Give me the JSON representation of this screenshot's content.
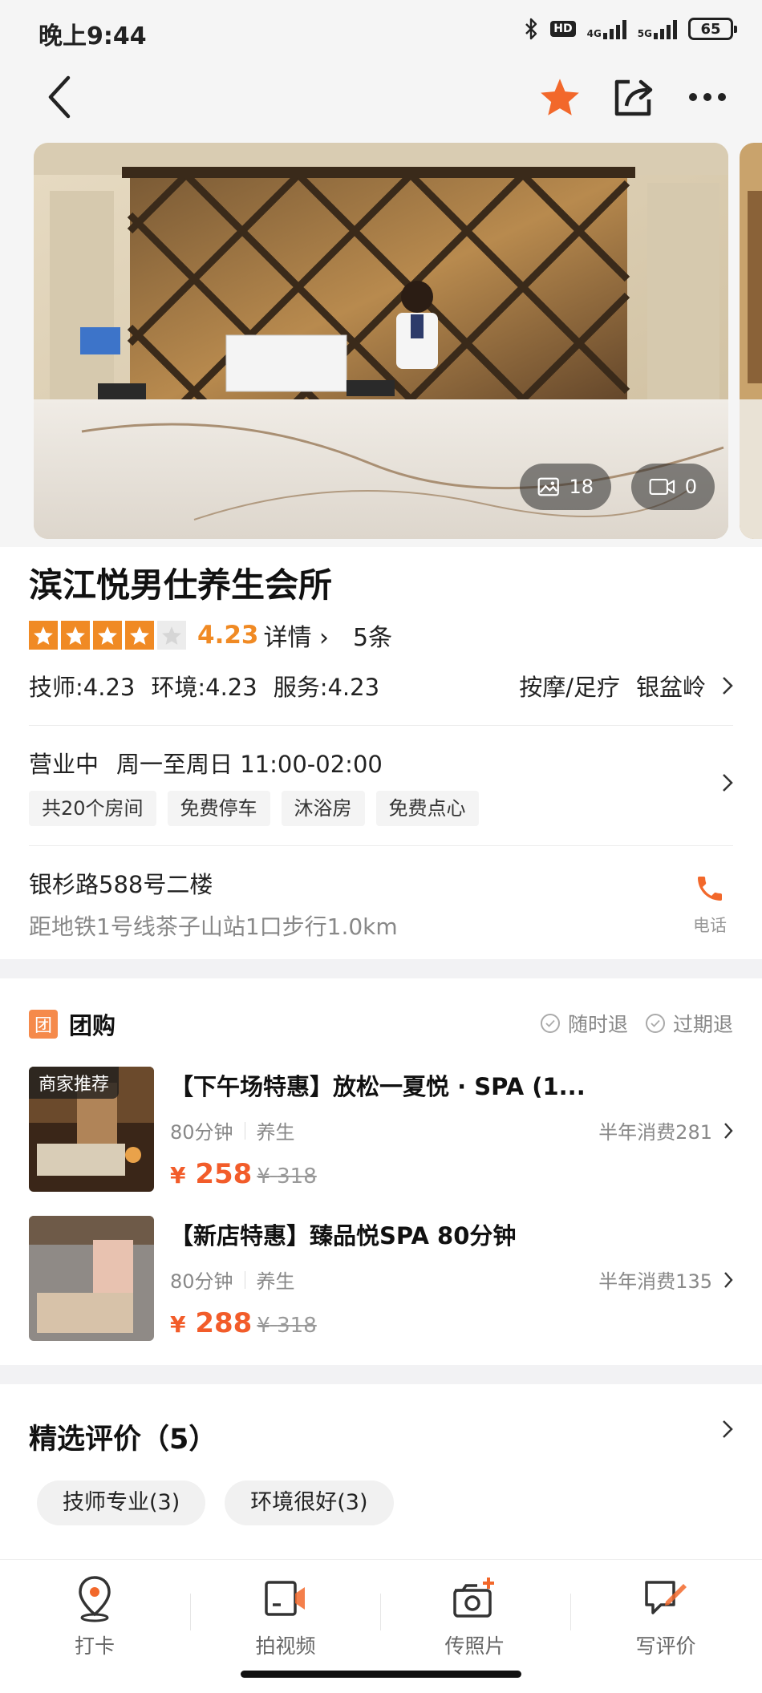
{
  "status_bar": {
    "time": "晚上9:44",
    "hd": "HD",
    "net1": "4G",
    "net2": "5G",
    "battery": "65",
    "icons": [
      "bluetooth-icon",
      "signal-icon",
      "battery-icon"
    ]
  },
  "nav": {
    "icons": [
      "back-icon",
      "star-icon",
      "share-icon",
      "more-icon"
    ],
    "favorite_color": "#f2682b"
  },
  "gallery": {
    "photo_count": "18",
    "video_count": "0"
  },
  "shop": {
    "name": "滨江悦男仕养生会所",
    "rating": {
      "stars": 4,
      "max_stars": 5,
      "score": "4.23",
      "detail_label": "详情",
      "review_count": "5条"
    },
    "sub_scores": [
      "技师:4.23",
      "环境:4.23",
      "服务:4.23"
    ],
    "category": [
      "按摩/足疗",
      "银盆岭"
    ],
    "status": "营业中",
    "hours": "周一至周日 11:00-02:00",
    "tags": [
      "共20个房间",
      "免费停车",
      "沐浴房",
      "免费点心"
    ],
    "address": "银杉路588号二楼",
    "transit": "距地铁1号线茶子山站1口步行1.0km",
    "phone_label": "电话",
    "accent_color": "#f08a24"
  },
  "group_buy": {
    "badge": "团",
    "title": "团购",
    "refund_any_time": "随时退",
    "refund_expired": "过期退",
    "deals": [
      {
        "badge": "商家推荐",
        "title": "【下午场特惠】放松一夏悦 · SPA (1...",
        "duration": "80分钟",
        "type": "养生",
        "sales": "半年消费281",
        "price_symbol": "¥",
        "price": "258",
        "original_symbol": "¥",
        "original_price": "318"
      },
      {
        "badge": "",
        "title": "【新店特惠】臻品悦SPA 80分钟",
        "duration": "80分钟",
        "type": "养生",
        "sales": "半年消费135",
        "price_symbol": "¥",
        "price": "288",
        "original_symbol": "¥",
        "original_price": "318"
      }
    ],
    "price_color": "#f25c2a"
  },
  "reviews": {
    "title": "精选评价（5）",
    "chips": [
      "技师专业(3)",
      "环境很好(3)"
    ]
  },
  "tab_bar": {
    "items": [
      {
        "label": "打卡",
        "icon": "location-pin-icon"
      },
      {
        "label": "拍视频",
        "icon": "video-camera-icon"
      },
      {
        "label": "传照片",
        "icon": "camera-plus-icon"
      },
      {
        "label": "写评价",
        "icon": "write-review-icon"
      }
    ]
  }
}
